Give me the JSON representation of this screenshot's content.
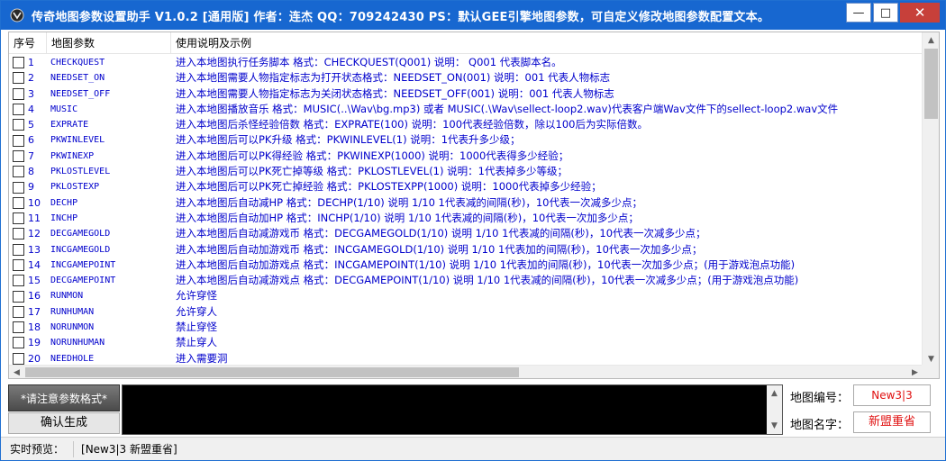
{
  "window": {
    "title": "传奇地图参数设置助手 V1.0.2 [通用版]   作者：连杰  QQ：709242430  PS：默认GEE引擎地图参数，可自定义修改地图参数配置文本。",
    "minimize": "—",
    "maximize": "□",
    "close": "✕"
  },
  "list": {
    "columns": [
      "序号",
      "地图参数",
      "使用说明及示例"
    ],
    "rows": [
      {
        "num": "1",
        "param": "CHECKQUEST",
        "desc": "进入本地图执行任务脚本 格式：CHECKQUEST(Q001) 说明： Q001 代表脚本名。"
      },
      {
        "num": "2",
        "param": "NEEDSET_ON",
        "desc": "进入本地图需要人物指定标志为打开状态格式：NEEDSET_ON(001) 说明：001 代表人物标志"
      },
      {
        "num": "3",
        "param": "NEEDSET_OFF",
        "desc": "进入本地图需要人物指定标志为关闭状态格式：NEEDSET_OFF(001) 说明：001 代表人物标志"
      },
      {
        "num": "4",
        "param": "MUSIC",
        "desc": "进入本地图播放音乐 格式：MUSIC(..\\Wav\\bg.mp3) 或者 MUSIC(.\\Wav\\sellect-loop2.wav)代表客户端Wav文件下的sellect-loop2.wav文件"
      },
      {
        "num": "5",
        "param": "EXPRATE",
        "desc": "进入本地图后杀怪经验倍数 格式：EXPRATE(100) 说明：100代表经验倍数，除以100后为实际倍数。"
      },
      {
        "num": "6",
        "param": "PKWINLEVEL",
        "desc": "进入本地图后可以PK升级 格式：PKWINLEVEL(1) 说明：1代表升多少级；"
      },
      {
        "num": "7",
        "param": "PKWINEXP",
        "desc": "进入本地图后可以PK得经验 格式：PKWINEXP(1000) 说明：1000代表得多少经验；"
      },
      {
        "num": "8",
        "param": "PKLOSTLEVEL",
        "desc": "进入本地图后可以PK死亡掉等级 格式：PKLOSTLEVEL(1) 说明：1代表掉多少等级；"
      },
      {
        "num": "9",
        "param": "PKLOSTEXP",
        "desc": "进入本地图后可以PK死亡掉经验 格式：PKLOSTEXPP(1000) 说明：1000代表掉多少经验；"
      },
      {
        "num": "10",
        "param": "DECHP",
        "desc": "进入本地图后自动减HP 格式：DECHP(1/10) 说明 1/10 1代表减的间隔(秒)，10代表一次减多少点；"
      },
      {
        "num": "11",
        "param": "INCHP",
        "desc": "进入本地图后自动加HP 格式：INCHP(1/10) 说明 1/10 1代表减的间隔(秒)，10代表一次加多少点；"
      },
      {
        "num": "12",
        "param": "DECGAMEGOLD",
        "desc": "进入本地图后自动减游戏币 格式：DECGAMEGOLD(1/10) 说明 1/10 1代表减的间隔(秒)，10代表一次减多少点；"
      },
      {
        "num": "13",
        "param": "INCGAMEGOLD",
        "desc": "进入本地图后自动加游戏币 格式：INCGAMEGOLD(1/10) 说明 1/10 1代表加的间隔(秒)，10代表一次加多少点；"
      },
      {
        "num": "14",
        "param": "INCGAMEPOINT",
        "desc": "进入本地图后自动加游戏点 格式：INCGAMEPOINT(1/10) 说明 1/10 1代表加的间隔(秒)，10代表一次加多少点；(用于游戏泡点功能)"
      },
      {
        "num": "15",
        "param": "DECGAMEPOINT",
        "desc": "进入本地图后自动减游戏点 格式：DECGAMEPOINT(1/10) 说明 1/10 1代表减的间隔(秒)，10代表一次减多少点；(用于游戏泡点功能)"
      },
      {
        "num": "16",
        "param": "RUNMON",
        "desc": "允许穿怪"
      },
      {
        "num": "17",
        "param": "RUNHUMAN",
        "desc": "允许穿人"
      },
      {
        "num": "18",
        "param": "NORUNMON",
        "desc": "禁止穿怪"
      },
      {
        "num": "19",
        "param": "NORUNHUMAN",
        "desc": "禁止穿人"
      },
      {
        "num": "20",
        "param": "NEEDHOLE",
        "desc": "进入需要洞"
      }
    ]
  },
  "controls": {
    "notice_button": "*请注意参数格式*",
    "confirm_button": "确认生成",
    "map_id_label": "地图编号：",
    "map_id_value": "New3|3",
    "map_name_label": "地图名字：",
    "map_name_value": "新盟重省"
  },
  "status": {
    "label": "实时预览：",
    "value": "[New3|3 新盟重省]"
  },
  "colors": {
    "titlebar": "#1767d0",
    "list_text": "#0000cc",
    "map_field_text": "#e01010"
  }
}
